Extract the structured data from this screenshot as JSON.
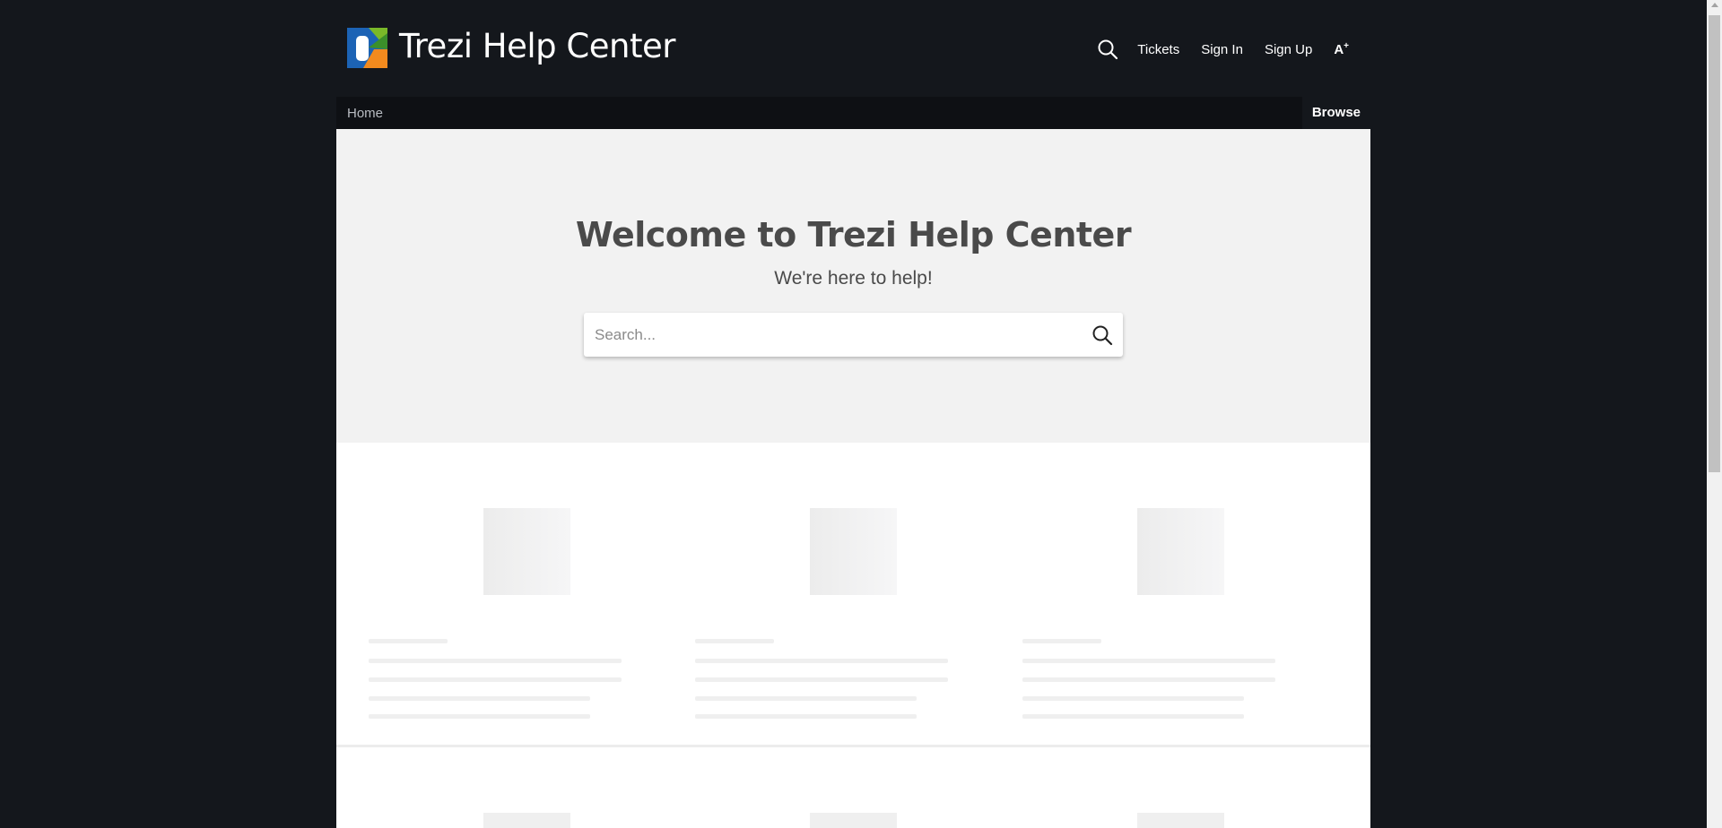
{
  "header": {
    "brand_title": "Trezi Help Center",
    "logo_icon": "trezi-logo",
    "nav": {
      "search_icon": "search-icon",
      "tickets": "Tickets",
      "sign_in": "Sign In",
      "sign_up": "Sign Up",
      "font_size_label": "A",
      "font_size_sup": "+"
    }
  },
  "subnav": {
    "home": "Home",
    "browse": "Browse"
  },
  "hero": {
    "title": "Welcome to Trezi Help Center",
    "subtitle": "We're here to help!",
    "search_placeholder": "Search...",
    "search_value": ""
  },
  "colors": {
    "page_background": "#14171c",
    "hero_background": "#f2f2f2",
    "content_background": "#ffffff",
    "skeleton": "#efefef"
  }
}
